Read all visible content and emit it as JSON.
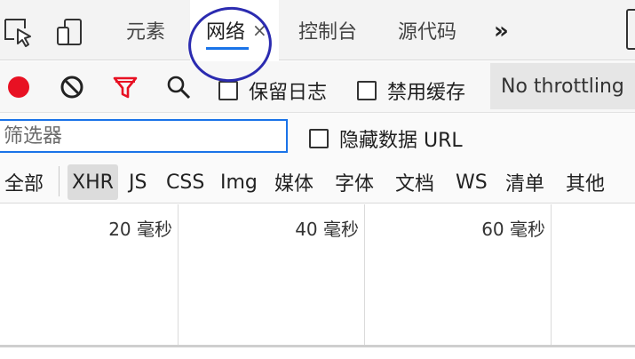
{
  "tabbar": {
    "tabs": [
      {
        "label": "元素"
      },
      {
        "label": "网络",
        "active": true
      },
      {
        "label": "控制台"
      },
      {
        "label": "源代码"
      }
    ],
    "close_glyph": "×",
    "overflow_glyph": "»"
  },
  "toolbar": {
    "record_color": "#e81123",
    "filter_color": "#e81123",
    "preserve_log_label": "保留日志",
    "disable_cache_label": "禁用缓存",
    "throttling_value": "No throttling"
  },
  "filter": {
    "placeholder": "筛选器",
    "hide_data_url_label": "隐藏数据 URL"
  },
  "types": {
    "items": [
      "全部",
      "XHR",
      "JS",
      "CSS",
      "Img",
      "媒体",
      "字体",
      "文档",
      "WS",
      "清单",
      "其他"
    ],
    "selected": "XHR"
  },
  "timeline": {
    "ticks": [
      "20 毫秒",
      "40 毫秒",
      "60 毫秒"
    ]
  },
  "icons": [
    "inspect-element-icon",
    "device-toolbar-icon",
    "record-icon",
    "clear-icon",
    "filter-icon",
    "search-icon"
  ]
}
